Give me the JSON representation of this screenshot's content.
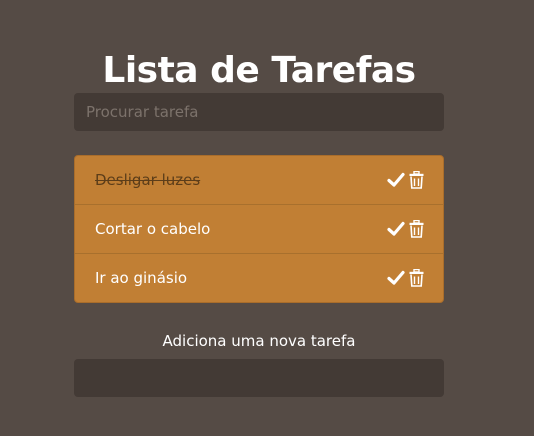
{
  "app": {
    "title": "Lista de Tarefas"
  },
  "search": {
    "placeholder": "Procurar tarefa",
    "value": ""
  },
  "tasks": [
    {
      "text": "Desligar luzes",
      "done": true
    },
    {
      "text": "Cortar o cabelo",
      "done": false
    },
    {
      "text": "Ir ao ginásio",
      "done": false
    }
  ],
  "task_actions": {
    "complete_icon": "check-icon",
    "delete_icon": "trash-icon"
  },
  "add_task": {
    "label": "Adiciona uma nova tarefa",
    "value": ""
  },
  "colors": {
    "background": "#554b45",
    "input_background": "#433a35",
    "list_background": "#c17f34",
    "text": "#ffffff",
    "done_text": "#5c3d19"
  }
}
